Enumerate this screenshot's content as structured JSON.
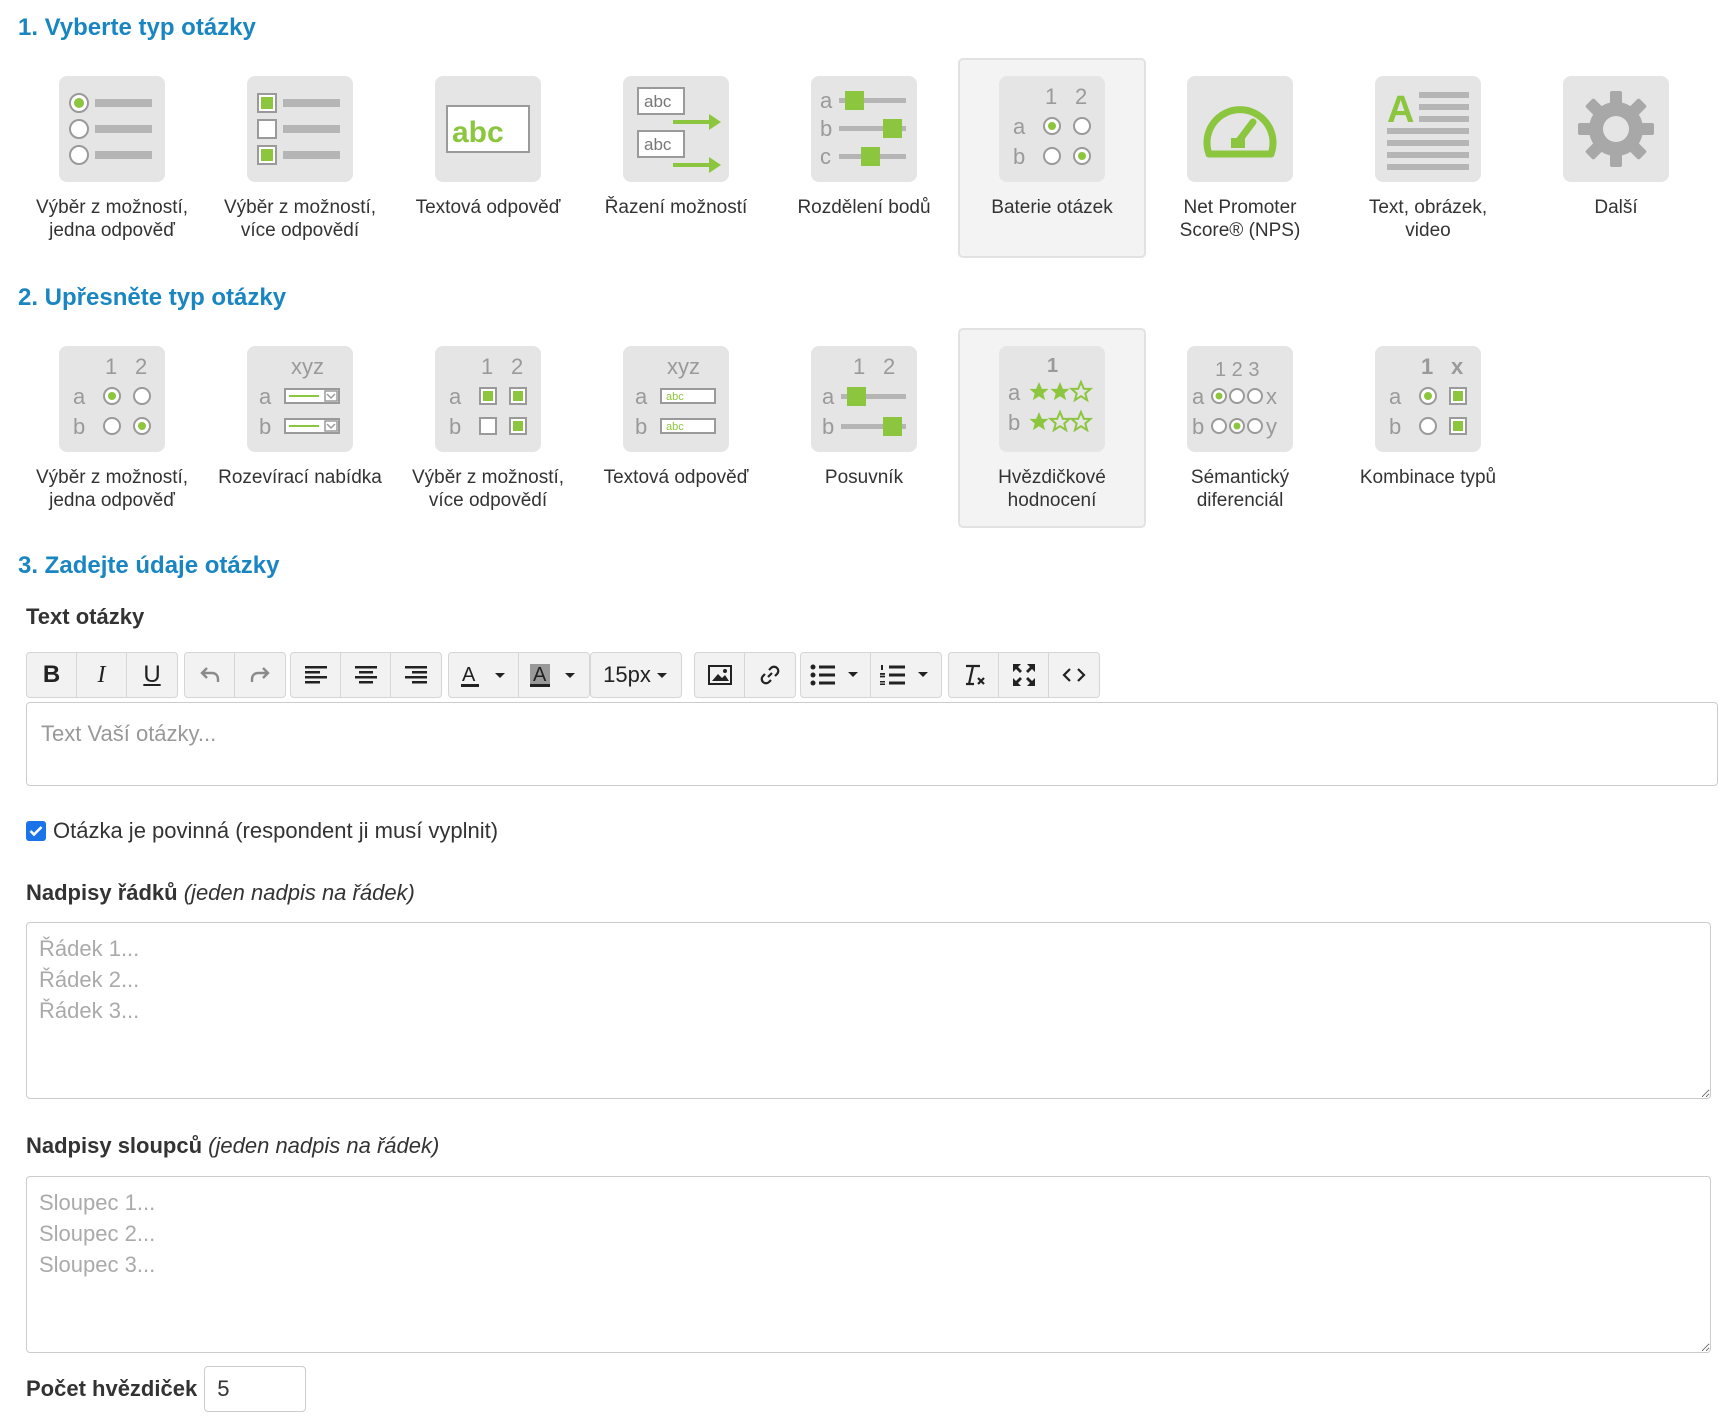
{
  "section1": {
    "title": "1. Vyberte typ otázky",
    "tiles": [
      {
        "label": "Výběr z možností,\njedna odpověď",
        "icon": "single-choice-icon"
      },
      {
        "label": "Výběr z možností,\nvíce odpovědí",
        "icon": "multiple-choice-icon"
      },
      {
        "label": "Textová odpověď",
        "icon": "text-answer-icon"
      },
      {
        "label": "Řazení možností",
        "icon": "ordering-icon"
      },
      {
        "label": "Rozdělení bodů",
        "icon": "points-distribution-icon"
      },
      {
        "label": "Baterie otázek",
        "icon": "question-battery-icon",
        "selected": true
      },
      {
        "label": "Net Promoter\nScore® (NPS)",
        "icon": "nps-gauge-icon"
      },
      {
        "label": "Text, obrázek,\nvideo",
        "icon": "text-image-video-icon"
      },
      {
        "label": "Další",
        "icon": "gear-icon"
      }
    ]
  },
  "section2": {
    "title": "2. Upřesněte typ otázky",
    "tiles": [
      {
        "label": "Výběr z možností,\njedna odpověď",
        "icon": "matrix-single-icon"
      },
      {
        "label": "Rozevírací nabídka",
        "icon": "matrix-dropdown-icon"
      },
      {
        "label": "Výběr z možností,\nvíce odpovědí",
        "icon": "matrix-multiple-icon"
      },
      {
        "label": "Textová odpověď",
        "icon": "matrix-text-icon"
      },
      {
        "label": "Posuvník",
        "icon": "matrix-slider-icon"
      },
      {
        "label": "Hvězdičkové\nhodnocení",
        "icon": "star-rating-icon",
        "selected": true
      },
      {
        "label": "Sémantický\ndiferenciál",
        "icon": "semantic-differential-icon"
      },
      {
        "label": "Kombinace typů",
        "icon": "combination-icon"
      }
    ]
  },
  "section3": {
    "title": "3. Zadejte údaje otázky",
    "question_text_label": "Text otázky",
    "toolbar": {
      "bold": "B",
      "italic": "I",
      "underline": "U",
      "font_size": "15px"
    },
    "question_placeholder": "Text Vaší otázky...",
    "required_label": "Otázka je povinná (respondent ji musí vyplnit)",
    "required_checked": true,
    "rows_label": "Nadpisy řádků",
    "rows_hint": "(jeden nadpis na řádek)",
    "rows_placeholder": "Řádek 1...\nŘádek 2...\nŘádek 3...",
    "cols_label": "Nadpisy sloupců",
    "cols_hint": "(jeden nadpis na řádek)",
    "cols_placeholder": "Sloupec 1...\nSloupec 2...\nSloupec 3...",
    "stars_label": "Počet hvězdiček",
    "stars_value": "5"
  },
  "icon_text": {
    "abc": "abc",
    "xyz": "xyz",
    "a": "a",
    "b": "b",
    "c": "c",
    "one": "1",
    "two": "2",
    "three": "3",
    "x": "x",
    "y": "y",
    "big_a": "A",
    "digits": "1 2 3"
  },
  "colors": {
    "accent": "#1a86c1",
    "green": "#8cc63f",
    "tile_bg": "#e5e5e5",
    "checkbox": "#1a73e8"
  }
}
